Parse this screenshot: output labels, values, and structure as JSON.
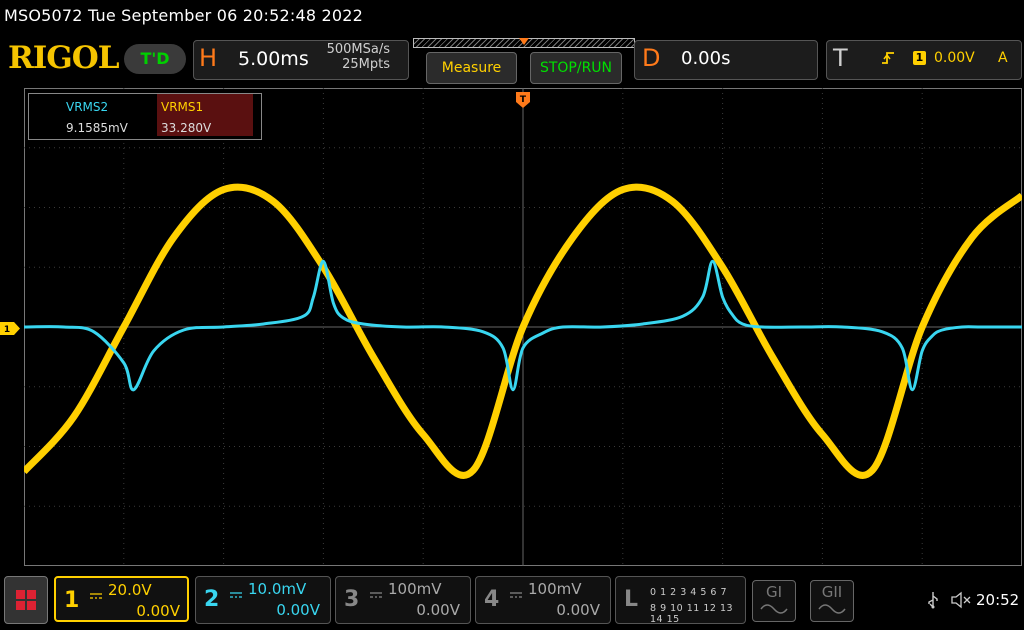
{
  "header": {
    "model_time": "MSO5072  Tue September 06 20:52:48 2022",
    "logo": "RIGOL",
    "run_state": "T'D"
  },
  "horizontal": {
    "letter": "H",
    "timebase": "5.00ms",
    "sample_rate": "500MSa/s",
    "memory_depth": "25Mpts"
  },
  "buttons": {
    "measure": "Measure",
    "stop_run": "STOP/RUN"
  },
  "delay": {
    "letter": "D",
    "value": "0.00s"
  },
  "trigger": {
    "letter": "T",
    "edge_icon": "rising-edge-icon",
    "source": "1",
    "level": "0.00V",
    "mode": "A"
  },
  "measurements": {
    "m2_name": "VRMS2",
    "m2_value": "9.1585mV",
    "m1_name": "VRMS1",
    "m1_value": "33.280V"
  },
  "markers": {
    "ch1_ground": "1",
    "trigger_pos": "T"
  },
  "channels": [
    {
      "num": "1",
      "coupling": "DC",
      "scale": "20.0V",
      "offset": "0.00V",
      "color": "#ffd000",
      "active": true
    },
    {
      "num": "2",
      "coupling": "DC",
      "scale": "10.0mV",
      "offset": "0.00V",
      "color": "#39d6f0",
      "active": true
    },
    {
      "num": "3",
      "coupling": "DC",
      "scale": "100mV",
      "offset": "0.00V",
      "color": "#888888",
      "active": false
    },
    {
      "num": "4",
      "coupling": "DC",
      "scale": "100mV",
      "offset": "0.00V",
      "color": "#888888",
      "active": false
    }
  ],
  "logic": {
    "letter": "L",
    "row1": "0 1 2 3  4 5 6 7",
    "row2": "8 9 10 11 12 13 14 15"
  },
  "generators": {
    "g1": "GI",
    "g2": "GII"
  },
  "status": {
    "usb_icon": "usb-icon",
    "speaker_icon": "speaker-muted-icon",
    "time": "20:52"
  },
  "colors": {
    "ch1": "#ffd000",
    "ch2": "#39d6f0",
    "accent": "#ff7a1a",
    "run_green": "#00e000"
  },
  "chart_data": {
    "type": "line",
    "xlabel": "",
    "ylabel": "",
    "x_unit": "ms",
    "x_range": [
      -25,
      25
    ],
    "series": [
      {
        "name": "1",
        "unit": "V",
        "x": [
          -25.0,
          -22.5,
          -20.0,
          -17.5,
          -15.0,
          -12.5,
          -10.0,
          -7.5,
          -5.0,
          -2.5,
          0.0,
          2.5,
          5.0,
          7.5,
          10.0,
          12.5,
          15.0,
          17.5,
          20.0,
          22.5,
          25.0
        ],
        "values": [
          -48.4,
          -30.0,
          0.0,
          30.0,
          46.0,
          42.0,
          20.0,
          -10.0,
          -36.0,
          -48.0,
          0.0,
          30.0,
          46.0,
          42.0,
          20.0,
          -10.0,
          -36.0,
          -48.0,
          0.0,
          30.0,
          44.0
        ]
      },
      {
        "name": "2",
        "unit": "mV",
        "x": [
          -25.0,
          -23.0,
          -21.5,
          -20.0,
          -19.5,
          -18.5,
          -17.0,
          -15.0,
          -13.0,
          -11.0,
          -10.5,
          -10.0,
          -9.5,
          -9.0,
          -8.0,
          -6.0,
          -4.0,
          -2.0,
          -1.0,
          -0.5,
          0.0,
          1.0,
          2.0,
          4.0,
          6.0,
          8.0,
          9.0,
          9.5,
          10.0,
          10.5,
          11.0,
          12.0,
          14.0,
          16.0,
          18.0,
          19.0,
          19.5,
          20.0,
          20.5,
          21.0,
          22.0,
          23.0,
          25.0
        ],
        "values": [
          0.0,
          0.0,
          -0.8,
          -6.0,
          -10.5,
          -4.0,
          -0.5,
          0.0,
          0.5,
          1.8,
          5.0,
          11.0,
          4.0,
          1.5,
          0.5,
          0.0,
          0.0,
          -0.8,
          -3.5,
          -10.5,
          -3.5,
          -1.0,
          0.0,
          0.0,
          0.5,
          1.8,
          5.0,
          11.0,
          5.0,
          2.0,
          0.5,
          0.0,
          0.0,
          0.0,
          -0.8,
          -3.5,
          -10.5,
          -4.0,
          -1.5,
          -0.5,
          0.0,
          0.0,
          0.0
        ]
      }
    ],
    "ylim_ch1": [
      -80,
      80
    ],
    "ylim_ch2": [
      -40,
      40
    ],
    "grid": true
  }
}
